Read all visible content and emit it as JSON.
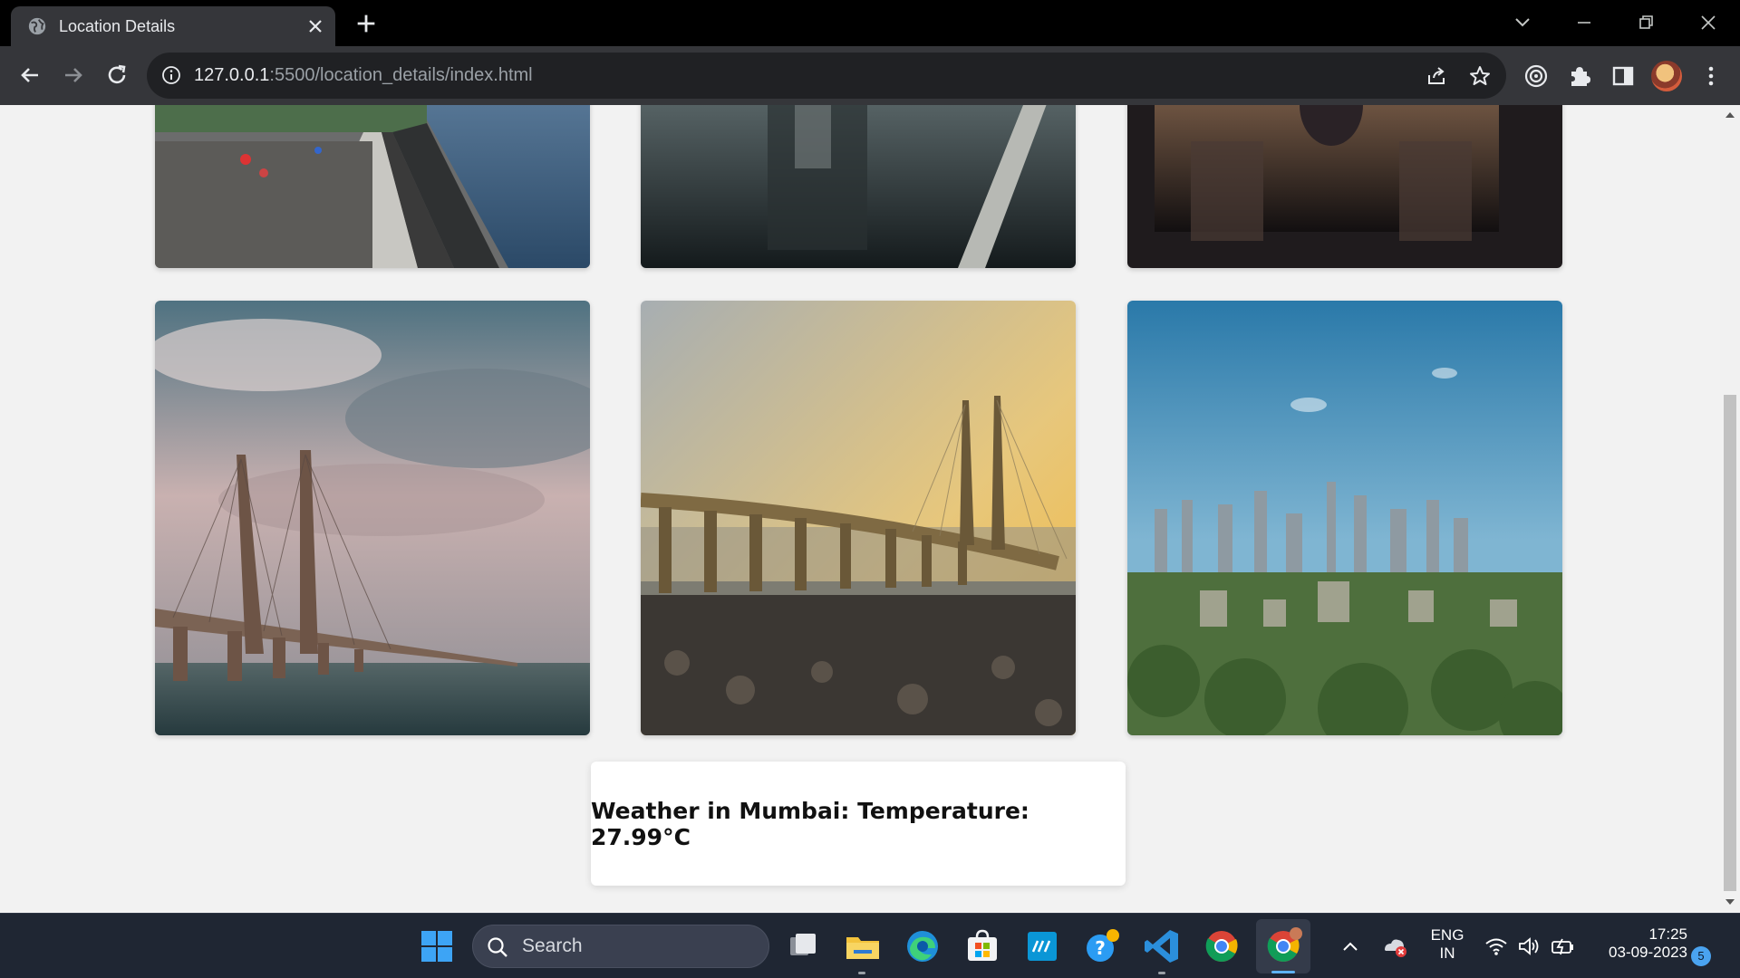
{
  "browser": {
    "tab_title": "Location Details",
    "url_host": "127.0.0.1",
    "url_path": ":5500/location_details/index.html"
  },
  "page": {
    "photos": [
      {
        "name": "marine-drive-promenade"
      },
      {
        "name": "rainy-reflection"
      },
      {
        "name": "gateway-reflection"
      },
      {
        "name": "sea-link-cloudy"
      },
      {
        "name": "sea-link-sunset"
      },
      {
        "name": "city-skyline"
      }
    ],
    "weather_text": "Weather in Mumbai: Temperature: 27.99°C"
  },
  "taskbar": {
    "search_label": "Search",
    "lang_line1": "ENG",
    "lang_line2": "IN",
    "time": "17:25",
    "date": "03-09-2023",
    "notification_count": "5"
  }
}
